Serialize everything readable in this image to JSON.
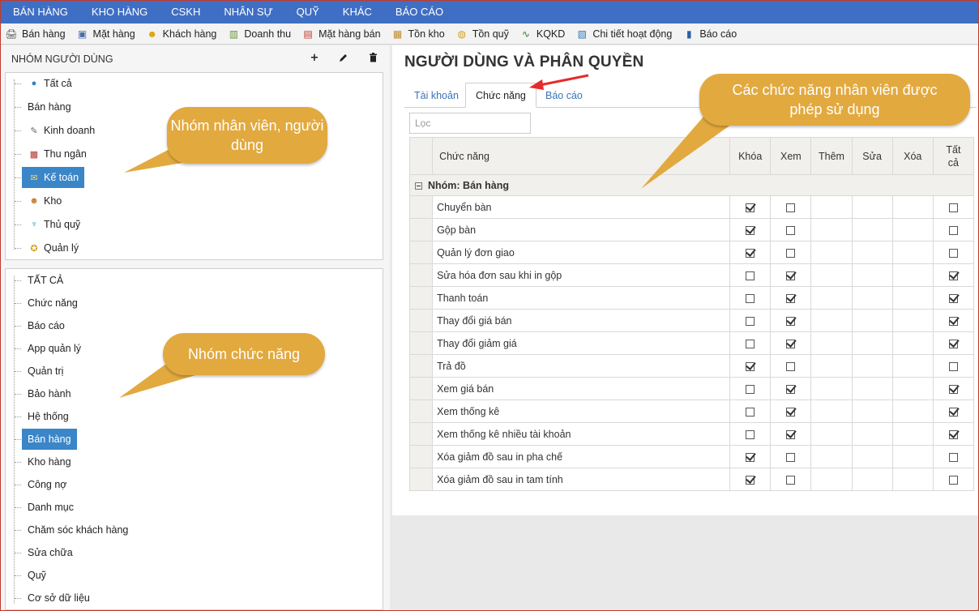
{
  "topnav": [
    "BÁN HÀNG",
    "KHO HÀNG",
    "CSKH",
    "NHÂN SỰ",
    "QUỸ",
    "KHÁC",
    "BÁO CÁO"
  ],
  "toolbar": [
    {
      "label": "Bán hàng",
      "icon": "cash-register-icon"
    },
    {
      "label": "Mặt hàng",
      "icon": "product-icon"
    },
    {
      "label": "Khách hàng",
      "icon": "customer-icon"
    },
    {
      "label": "Doanh thu",
      "icon": "revenue-chart-icon"
    },
    {
      "label": "Mặt hàng bán",
      "icon": "sales-chart-icon"
    },
    {
      "label": "Tồn kho",
      "icon": "stock-boxes-icon"
    },
    {
      "label": "Tồn quỹ",
      "icon": "coins-icon"
    },
    {
      "label": "KQKD",
      "icon": "business-result-icon"
    },
    {
      "label": "Chi tiết hoạt động",
      "icon": "activity-log-icon"
    },
    {
      "label": "Báo cáo",
      "icon": "report-icon"
    }
  ],
  "left": {
    "title": "NHÓM NGƯỜI DÙNG",
    "add_label": "+",
    "user_groups": [
      {
        "label": "Tất cả",
        "icon": "globe-icon"
      },
      {
        "label": "Bán hàng",
        "icon": ""
      },
      {
        "label": "Kinh doanh",
        "icon": "business-icon"
      },
      {
        "label": "Thu ngân",
        "icon": "cashier-icon"
      },
      {
        "label": "Kế toán",
        "icon": "accountant-icon"
      },
      {
        "label": "Kho",
        "icon": "warehouse-user-icon"
      },
      {
        "label": "Thủ quỹ",
        "icon": "treasurer-icon"
      },
      {
        "label": "Quản lý",
        "icon": "manager-badge-icon"
      }
    ],
    "selected_user_group": 4,
    "function_groups": [
      "TẤT CẢ",
      "Chức năng",
      "Báo cáo",
      "App quản lý",
      "Quản trị",
      "Bảo hành",
      "Hệ thống",
      "Bán hàng",
      "Kho hàng",
      "Công nợ",
      "Danh mục",
      "Chăm sóc khách hàng",
      "Sửa chữa",
      "Quỹ",
      "Cơ sở dữ liệu"
    ],
    "selected_function_group": 7
  },
  "main": {
    "title": "NGƯỜI DÙNG VÀ PHÂN QUYỀN",
    "tabs": [
      "Tài khoản",
      "Chức năng",
      "Báo cáo"
    ],
    "active_tab": 1,
    "filter_placeholder": "Lọc",
    "columns": [
      "Chức năng",
      "Khóa",
      "Xem",
      "Thêm",
      "Sửa",
      "Xóa",
      "Tất cả"
    ],
    "group_label": "Nhóm: Bán hàng",
    "rows": [
      {
        "name": "Chuyển bàn",
        "khoa": true,
        "xem": false,
        "them": null,
        "sua": null,
        "xoa": null,
        "tatca": false
      },
      {
        "name": "Gộp bàn",
        "khoa": true,
        "xem": false,
        "them": null,
        "sua": null,
        "xoa": null,
        "tatca": false
      },
      {
        "name": "Quản lý đơn giao",
        "khoa": true,
        "xem": false,
        "them": null,
        "sua": null,
        "xoa": null,
        "tatca": false
      },
      {
        "name": "Sửa hóa đơn sau khi in gộp",
        "khoa": false,
        "xem": true,
        "them": null,
        "sua": null,
        "xoa": null,
        "tatca": true
      },
      {
        "name": "Thanh toán",
        "khoa": false,
        "xem": true,
        "them": null,
        "sua": null,
        "xoa": null,
        "tatca": true
      },
      {
        "name": "Thay đổi giá bán",
        "khoa": false,
        "xem": true,
        "them": null,
        "sua": null,
        "xoa": null,
        "tatca": true
      },
      {
        "name": "Thay đổi giảm giá",
        "khoa": false,
        "xem": true,
        "them": null,
        "sua": null,
        "xoa": null,
        "tatca": true
      },
      {
        "name": "Trả đồ",
        "khoa": true,
        "xem": false,
        "them": null,
        "sua": null,
        "xoa": null,
        "tatca": false
      },
      {
        "name": "Xem giá bán",
        "khoa": false,
        "xem": true,
        "them": null,
        "sua": null,
        "xoa": null,
        "tatca": true
      },
      {
        "name": "Xem thống kê",
        "khoa": false,
        "xem": true,
        "them": null,
        "sua": null,
        "xoa": null,
        "tatca": true
      },
      {
        "name": "Xem thống kê nhiều tài khoản",
        "khoa": false,
        "xem": true,
        "them": null,
        "sua": null,
        "xoa": null,
        "tatca": true
      },
      {
        "name": "Xóa giảm đồ sau in pha chế",
        "khoa": true,
        "xem": false,
        "them": null,
        "sua": null,
        "xoa": null,
        "tatca": false
      },
      {
        "name": "Xóa giảm đồ sau in tam tính",
        "khoa": true,
        "xem": false,
        "them": null,
        "sua": null,
        "xoa": null,
        "tatca": false
      }
    ]
  },
  "callouts": {
    "user_group": "Nhóm nhân viên, người dùng",
    "function_group": "Nhóm chức năng",
    "functions": "Các chức năng nhân viên được phép sử dụng"
  },
  "colors": {
    "nav": "#3f6fc4",
    "selected": "#3a86c8",
    "callout": "#e2a93f",
    "arrow": "#e52b2b"
  }
}
